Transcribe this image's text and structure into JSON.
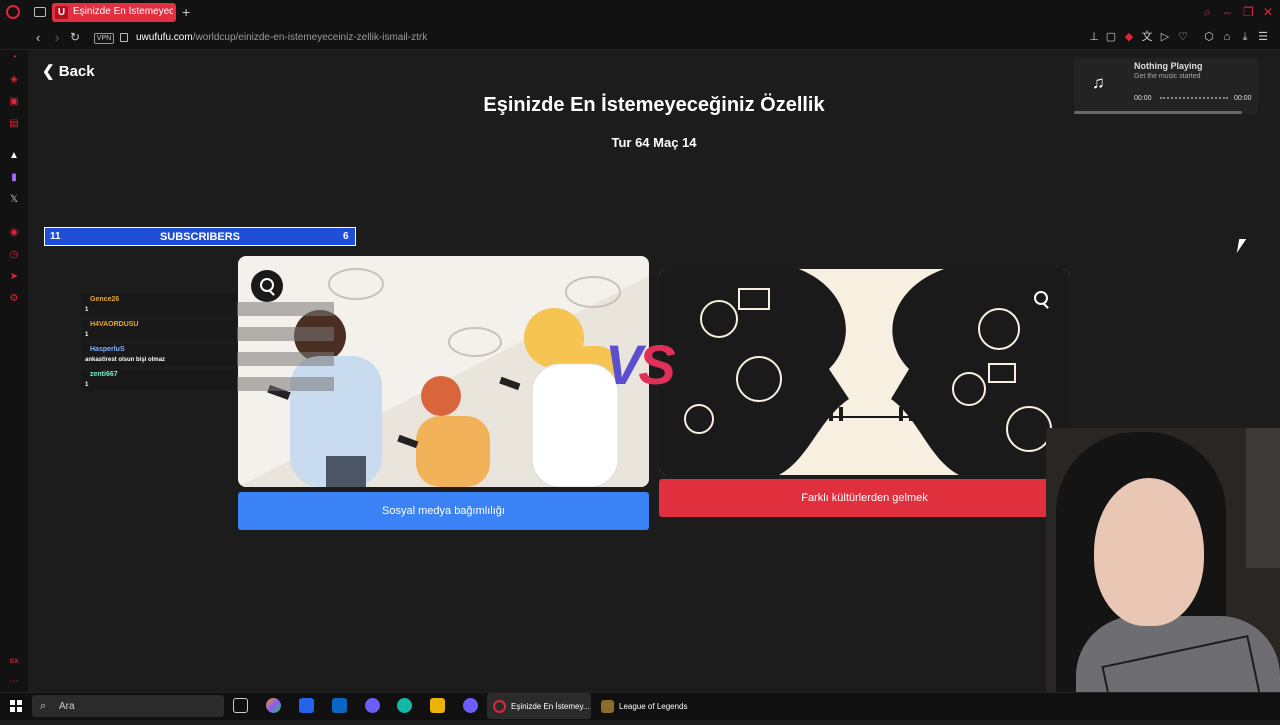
{
  "browser": {
    "tab": {
      "favicon": "U",
      "title": "Eşinizde En İstemeyeceğ"
    },
    "url": {
      "host": "uwufufu.com",
      "path": "/worldcup/einizde-en-istemeyeceiniz-zellik-ismail-ztrk"
    },
    "vpn_label": "VPN",
    "nav": {
      "back": "‹",
      "forward": "›",
      "reload": "↻",
      "new_tab": "+"
    }
  },
  "page": {
    "back_label": "Back",
    "title": "Eşinizde En İstemeyeceğiniz Özellik",
    "round_label": "Tur 64 Maç 14",
    "vs_v": "V",
    "vs_s": "S"
  },
  "music": {
    "status": "Nothing Playing",
    "subtitle": "Get the music started",
    "time_start": "00:00",
    "time_end": "00:00",
    "icon": "music-note"
  },
  "subscribers": {
    "left_count": "11",
    "label": "SUBSCRIBERS",
    "right_count": "6"
  },
  "choices": [
    {
      "label": "Sosyal medya bağımlılığı",
      "color": "#3b82f6"
    },
    {
      "label": "Farklı kültürlerden gelmek",
      "color": "#e0303e"
    }
  ],
  "chat": [
    {
      "user": "Gence26",
      "message": "1",
      "color": "#e6a935"
    },
    {
      "user": "H4VAORDUSU",
      "message": "1",
      "color": "#e6a935"
    },
    {
      "user": "HasperluS",
      "message": "ankastirest olsun bişi olmaz",
      "color": "#7fb2ff"
    },
    {
      "user": "zenti667",
      "message": "1",
      "color": "#7ff0c8"
    }
  ],
  "taskbar": {
    "search_placeholder": "Ara",
    "apps": [
      {
        "label": "Eşinizde En İstemey..."
      },
      {
        "label": "League of Legends"
      }
    ]
  }
}
